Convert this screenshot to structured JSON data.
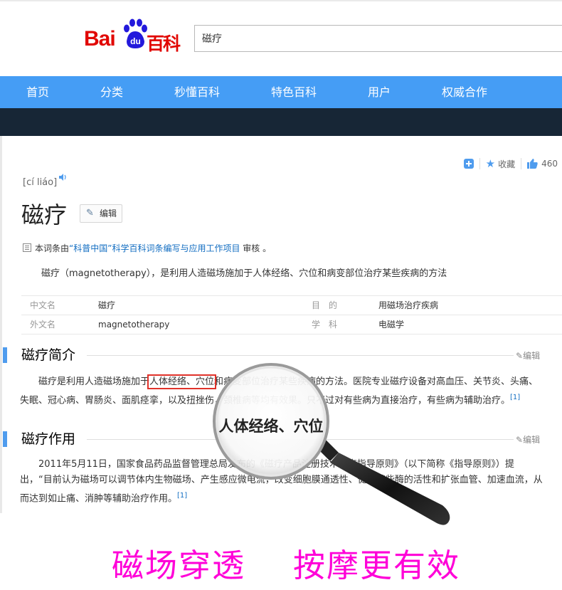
{
  "header": {
    "logo_bai": "Bai",
    "logo_du": "du",
    "logo_baike": "百科",
    "search_value": "磁疗"
  },
  "nav": {
    "items": [
      "首页",
      "分类",
      "秒懂百科",
      "特色百科",
      "用户",
      "权威合作"
    ]
  },
  "entry": {
    "collect_label": "收藏",
    "like_count": "460",
    "pinyin": "[cí liáo]",
    "title": "磁疗",
    "edit_label": "编辑",
    "review_prefix": "本词条由",
    "review_link1": "“科普中国”",
    "review_link2": "科学百科词条编写与应用工作项目",
    "review_suffix": " 审核 。",
    "summary": "磁疗（magnetotherapy），是利用人造磁场施加于人体经络、穴位和病变部位治疗某些疾病的方法",
    "info": [
      {
        "k1": "中文名",
        "v1": "磁疗",
        "k2": "目　的",
        "v2": "用磁场治疗疾病"
      },
      {
        "k1": "外文名",
        "v1": "magnetotherapy",
        "k2": "学　科",
        "v2": "电磁学"
      }
    ]
  },
  "sections": [
    {
      "heading": "磁疗简介",
      "edit": "编辑",
      "p_pre": "磁疗是利用人造磁场施加于",
      "p_hl": "人体经络、穴位",
      "p_post": "和病变部位治疗某些疾病的方法。医院专业磁疗设备对高血压、关节炎、头痛、失眠、冠心病、胃肠炎、面肌痉挛，以及扭挫伤，颈椎病等均有效果。只不过对有些病为直接治疗，有些病为辅助治疗。",
      "ref": "[1]"
    },
    {
      "heading": "磁疗作用",
      "edit": "编辑",
      "p": "2011年5月11日，国家食品药品监督管理总局发布的《磁疗产品注册技术审查指导原则》（以下简称《指导原则》）提出，“目前认为磁场可以调节体内生物磁场、产生感应微电流，改变细胞膜通透性、促进某些酶的活性和扩张血管、加速血流，从而达到如止痛、消肿等辅助治疗作用。",
      "ref": "[1]"
    }
  ],
  "magnifier_text": "人体经络、穴位",
  "slogan": {
    "left": "磁场穿透",
    "right": "按摩更有效"
  },
  "colors": {
    "nav_blue": "#459df5",
    "dark_band": "#172636",
    "logo_red": "#e10601",
    "slogan_magenta": "#ff00d8",
    "link_blue": "#136ec2"
  }
}
